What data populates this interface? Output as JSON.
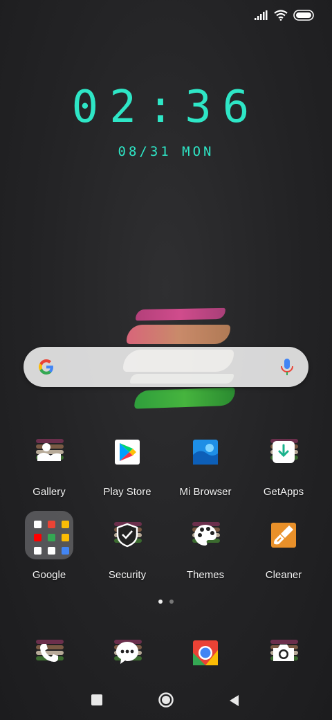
{
  "status_bar": {
    "icons": [
      "signal-icon",
      "wifi-icon",
      "battery-icon"
    ]
  },
  "clock": {
    "time": "02:36",
    "date": "08/31 MON",
    "color": "#2ee6c6"
  },
  "search": {
    "left_icon": "google-g-icon",
    "right_icon": "mic-icon"
  },
  "apps_row1": [
    {
      "label": "Gallery",
      "icon": "gallery-icon"
    },
    {
      "label": "Play Store",
      "icon": "play-store-icon"
    },
    {
      "label": "Mi Browser",
      "icon": "mi-browser-icon"
    },
    {
      "label": "GetApps",
      "icon": "getapps-icon"
    }
  ],
  "apps_row2": [
    {
      "label": "Google",
      "icon": "google-folder"
    },
    {
      "label": "Security",
      "icon": "security-icon"
    },
    {
      "label": "Themes",
      "icon": "themes-icon"
    },
    {
      "label": "Cleaner",
      "icon": "cleaner-icon"
    }
  ],
  "page_indicator": {
    "pages": 2,
    "current": 1
  },
  "dock": [
    {
      "icon": "phone-icon"
    },
    {
      "icon": "messaging-icon"
    },
    {
      "icon": "chrome-icon"
    },
    {
      "icon": "camera-icon"
    }
  ],
  "nav_bar": [
    "recents-button",
    "home-button",
    "back-button"
  ]
}
